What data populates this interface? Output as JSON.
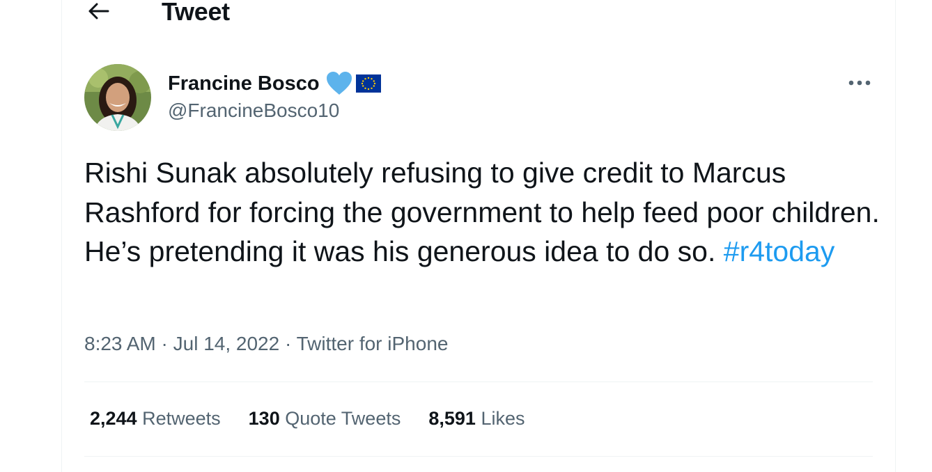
{
  "header": {
    "title": "Tweet"
  },
  "tweet": {
    "author": {
      "name": "Francine Bosco",
      "handle": "@FrancineBosco10"
    },
    "text_main": "Rishi Sunak absolutely refusing to give credit to Marcus Rashford for forcing the government to help feed poor children. He’s pretending it was his generous idea to do so.",
    "hashtag": "#r4today",
    "meta": {
      "time": "8:23 AM",
      "separator": " · ",
      "date": "Jul 14, 2022",
      "source": "Twitter for iPhone"
    },
    "stats": {
      "retweets_count": "2,244",
      "retweets_label": "Retweets",
      "quotes_count": "130",
      "quotes_label": "Quote Tweets",
      "likes_count": "8,591",
      "likes_label": "Likes"
    }
  },
  "icons": {
    "back": "arrow-left-icon",
    "more": "more-horizontal-icon",
    "badge1": "blue-heart-icon",
    "badge2": "eu-flag-icon"
  },
  "colors": {
    "accent": "#1d9bf0",
    "secondary_text": "#536471",
    "primary_text": "#0f1419",
    "divider": "#eff3f4",
    "heart": "#5db3ec",
    "eu_blue": "#003399",
    "eu_star": "#ffcc00"
  }
}
